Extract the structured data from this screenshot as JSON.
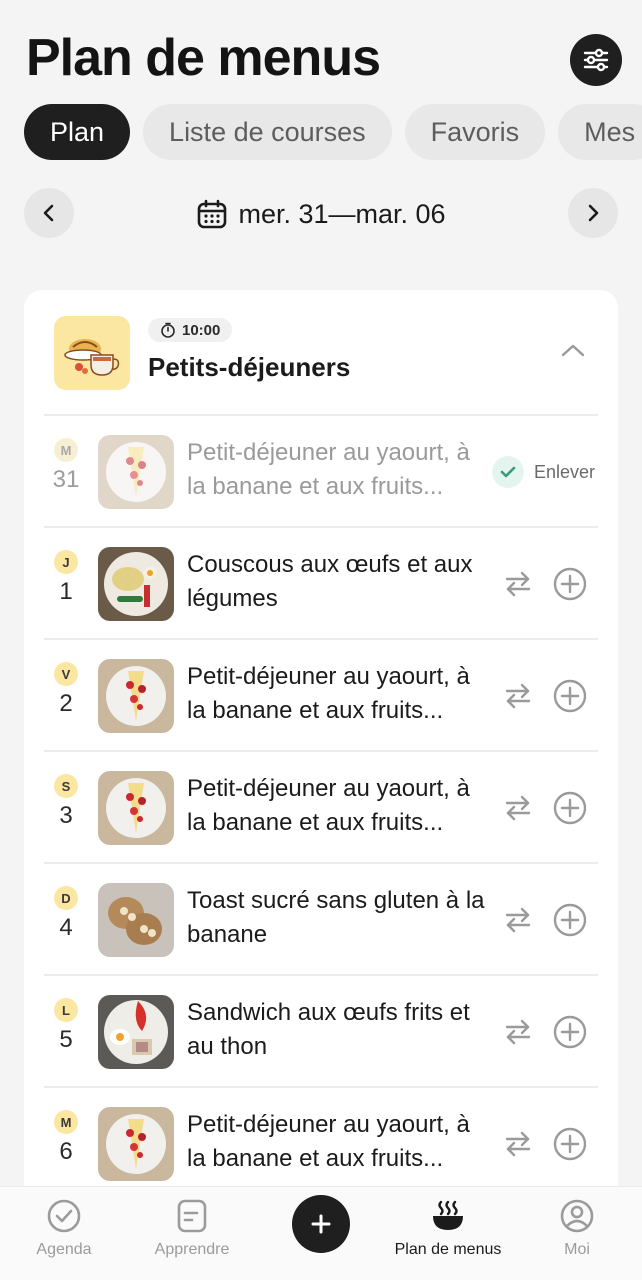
{
  "header": {
    "title": "Plan de menus",
    "filter_icon": "sliders-icon"
  },
  "tabs": [
    {
      "label": "Plan",
      "active": true
    },
    {
      "label": "Liste de courses",
      "active": false
    },
    {
      "label": "Favoris",
      "active": false
    },
    {
      "label": "Mes",
      "active": false
    }
  ],
  "week": {
    "label": "mer. 31—mar. 06",
    "prev_icon": "chevron-left-icon",
    "next_icon": "chevron-right-icon",
    "calendar_icon": "calendar-icon"
  },
  "meal": {
    "time": "10:00",
    "title": "Petits-déjeuners",
    "timer_icon": "stopwatch-icon",
    "collapse_icon": "chevron-up-icon"
  },
  "rows": [
    {
      "day_letter": "M",
      "day_num": "31",
      "recipe": "Petit-déjeuner au yaourt, à la banane et aux fruits...",
      "done": true,
      "action_label": "Enlever"
    },
    {
      "day_letter": "J",
      "day_num": "1",
      "recipe": "Couscous aux œufs et aux légumes",
      "done": false
    },
    {
      "day_letter": "V",
      "day_num": "2",
      "recipe": "Petit-déjeuner au yaourt, à la banane et aux fruits...",
      "done": false
    },
    {
      "day_letter": "S",
      "day_num": "3",
      "recipe": "Petit-déjeuner au yaourt, à la banane et aux fruits...",
      "done": false
    },
    {
      "day_letter": "D",
      "day_num": "4",
      "recipe": "Toast sucré sans gluten à la banane",
      "done": false
    },
    {
      "day_letter": "L",
      "day_num": "5",
      "recipe": "Sandwich aux œufs frits et au thon",
      "done": false
    },
    {
      "day_letter": "M",
      "day_num": "6",
      "recipe": "Petit-déjeuner au yaourt, à la banane et aux fruits...",
      "done": false
    }
  ],
  "bottom_nav": {
    "agenda": "Agenda",
    "learn": "Apprendre",
    "menu_plan": "Plan de menus",
    "me": "Moi"
  },
  "colors": {
    "accent_dark": "#1f1f1f",
    "day_badge": "#fbe7a2",
    "check": "#3a9a7a"
  }
}
